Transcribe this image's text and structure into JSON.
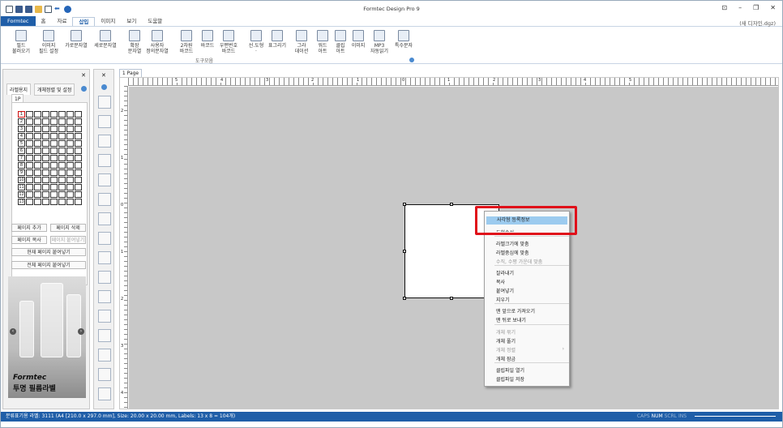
{
  "app": {
    "title": "Formtec Design Pro 9",
    "doc_name": "(새 디자인.dgz)"
  },
  "menu": {
    "file": "Formtec",
    "tabs": [
      "홈",
      "자료",
      "삽입",
      "이미지",
      "보기",
      "도움말"
    ],
    "active": "삽입"
  },
  "ribbon": {
    "buttons": [
      {
        "label": "필드\n불러오기",
        "icon": "field-load-icon"
      },
      {
        "label": "이미지\n필드 설정",
        "icon": "image-field-icon"
      },
      {
        "label": "가로문자열",
        "icon": "horizontal-text-icon"
      },
      {
        "label": "세로문자열",
        "icon": "vertical-text-icon"
      },
      {
        "label": "확장\n문자열",
        "icon": "extended-text-icon"
      },
      {
        "label": "사용자\n정의문자열",
        "icon": "custom-text-icon"
      },
      {
        "label": "2차원\n바코드",
        "icon": "2d-barcode-icon"
      },
      {
        "label": "바코드",
        "icon": "barcode-icon"
      },
      {
        "label": "우편번호\n바코드",
        "icon": "postal-barcode-icon"
      },
      {
        "label": "선.도형\n·",
        "icon": "shape-icon"
      },
      {
        "label": "표그리기",
        "icon": "table-icon"
      },
      {
        "label": "그라\n데이션",
        "icon": "gradient-icon"
      },
      {
        "label": "워드\n아트",
        "icon": "wordart-icon"
      },
      {
        "label": "클립\n아트",
        "icon": "clipart-icon"
      },
      {
        "label": "이미지",
        "icon": "image-icon"
      },
      {
        "label": "MP3\n자동읽기",
        "icon": "mp3-icon"
      },
      {
        "label": "특수문자",
        "icon": "special-char-icon"
      }
    ],
    "group_label": "도구모음"
  },
  "left_panel": {
    "tabs": [
      "라벨용지",
      "개체정렬 및 설정"
    ],
    "page_tab": "1P",
    "row_numbers": [
      "1",
      "2",
      "3",
      "4",
      "5",
      "6",
      "7",
      "8",
      "9",
      "10",
      "11",
      "12",
      "13"
    ],
    "buttons": {
      "add_page": "페이지 추가",
      "delete_page": "페이지 삭제",
      "copy_page": "페이지 복사",
      "paste_page": "페이지 붙여넣기",
      "paste_current": "현재 페이지 붙여넣기",
      "paste_all": "전체 페이지 붙여넣기"
    },
    "ad": {
      "brand": "Formtec",
      "text": "투명 필름라벨"
    }
  },
  "canvas": {
    "page_tab": "1 Page",
    "hruler_labels": [
      "5",
      "4",
      "3",
      "2",
      "1",
      "0",
      "1",
      "2",
      "3",
      "4",
      "5"
    ],
    "vruler_labels": [
      "2",
      "1",
      "0",
      "1",
      "2",
      "3",
      "4"
    ]
  },
  "context_menu": {
    "items": [
      {
        "label": "사각형 등록정보",
        "state": "highlight"
      },
      {
        "label": "도형속성",
        "state": "partial"
      },
      {
        "label": "라벨크기에 맞춤",
        "state": "normal"
      },
      {
        "label": "라벨중심에 맞춤",
        "state": "normal"
      },
      {
        "label": "수직, 수평 가운데 맞춤",
        "state": "disabled"
      },
      {
        "label": "잘라내기",
        "state": "normal"
      },
      {
        "label": "복사",
        "state": "normal"
      },
      {
        "label": "붙여넣기",
        "state": "normal"
      },
      {
        "label": "지우기",
        "state": "normal"
      },
      {
        "label": "맨 앞으로 가져오기",
        "state": "normal"
      },
      {
        "label": "맨 뒤로 보내기",
        "state": "normal"
      },
      {
        "label": "개체 묶기",
        "state": "disabled"
      },
      {
        "label": "개체 풀기",
        "state": "normal"
      },
      {
        "label": "개체 정렬",
        "state": "disabled"
      },
      {
        "label": "개체 잠금",
        "state": "normal"
      },
      {
        "label": "클립파일 열기",
        "state": "normal"
      },
      {
        "label": "클립파일 저장",
        "state": "normal"
      }
    ]
  },
  "status": {
    "left": "분류표기용 라벨: 3111 (A4 [210.0 x 297.0 mm], Size: 20.00 x 20.00 mm,  Labels: 13 x 8 = 104개)",
    "caps": "CAPS",
    "num": "NUM",
    "scrl": "SCRL",
    "ins": "INS"
  },
  "colors": {
    "accent": "#1f5ea8",
    "highlight": "#9ccbef",
    "annotation": "#e0101a"
  }
}
